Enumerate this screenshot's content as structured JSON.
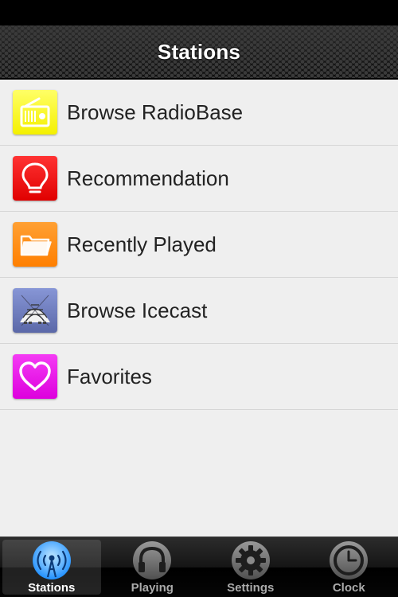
{
  "header": {
    "title": "Stations"
  },
  "list": {
    "items": [
      {
        "label": "Browse RadioBase",
        "icon": "radio-icon",
        "color": "#ffff00"
      },
      {
        "label": "Recommendation",
        "icon": "lightbulb-icon",
        "color": "#ff0000"
      },
      {
        "label": "Recently Played",
        "icon": "folder-icon",
        "color": "#ff8800"
      },
      {
        "label": "Browse Icecast",
        "icon": "icecast-logo-icon",
        "color": "#6f7fbf"
      },
      {
        "label": "Favorites",
        "icon": "heart-icon",
        "color": "#ee00ee"
      }
    ]
  },
  "tabs": [
    {
      "label": "Stations",
      "icon": "broadcast-icon",
      "selected": true
    },
    {
      "label": "Playing",
      "icon": "headphones-icon",
      "selected": false
    },
    {
      "label": "Settings",
      "icon": "gear-icon",
      "selected": false
    },
    {
      "label": "Clock",
      "icon": "clock-icon",
      "selected": false
    }
  ],
  "colors": {
    "accent": "#3aa0ff",
    "background": "#efefef"
  }
}
